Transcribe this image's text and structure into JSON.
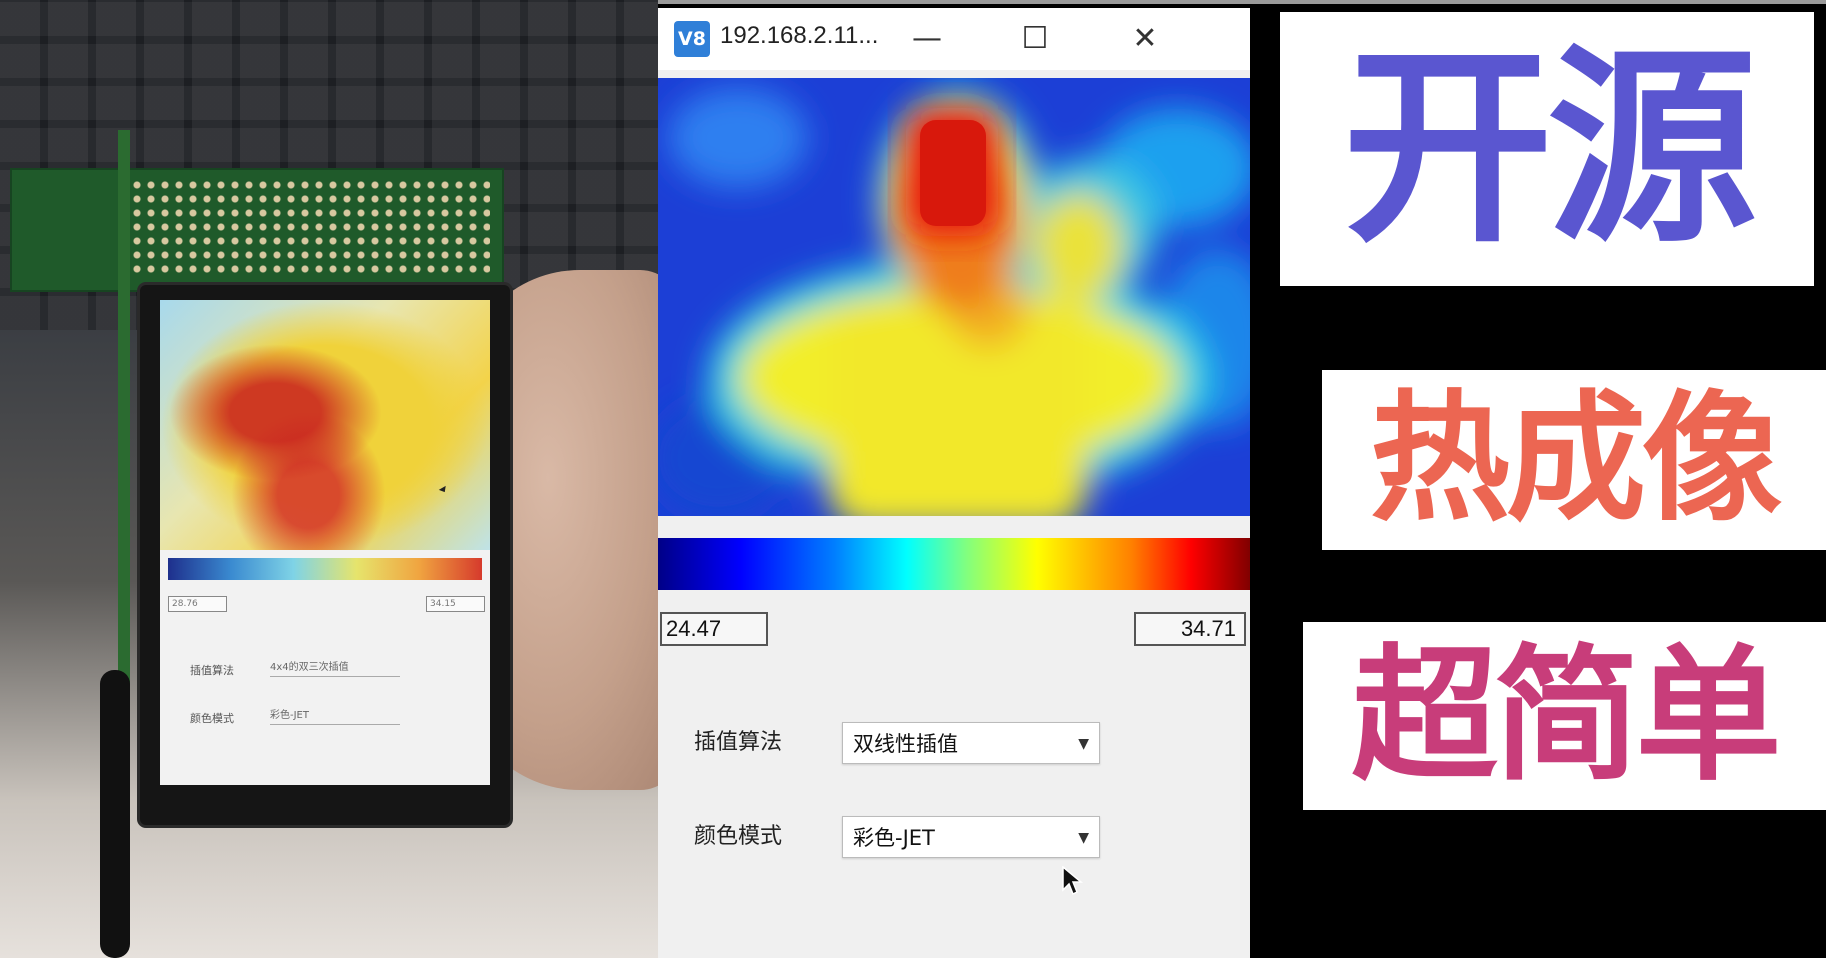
{
  "window": {
    "app_icon_text": "V8",
    "title": "192.168.2.11...",
    "minimize_glyph": "—",
    "maximize_glyph": "☐",
    "close_glyph": "✕"
  },
  "thermal": {
    "min_value": "24.47",
    "max_value": "34.71"
  },
  "controls": {
    "interp_label": "插值算法",
    "interp_value": "双线性插值",
    "color_label": "颜色模式",
    "color_value": "彩色-JET"
  },
  "device_screen": {
    "min_value": "28.76",
    "max_value": "34.15",
    "interp_label": "插值算法",
    "interp_value": "4x4的双三次插值",
    "color_label": "颜色模式",
    "color_value": "彩色-JET"
  },
  "banner": {
    "line1": "开源",
    "line2": "热成像",
    "line3": "超简单"
  },
  "colors": {
    "line1": "#5a56d0",
    "line2": "#ec6652",
    "line3": "#c83d7a",
    "app_icon": "#2f7fd8"
  },
  "icons": {
    "dropdown": "chevron-down-icon",
    "cursor": "mouse-pointer-icon"
  }
}
